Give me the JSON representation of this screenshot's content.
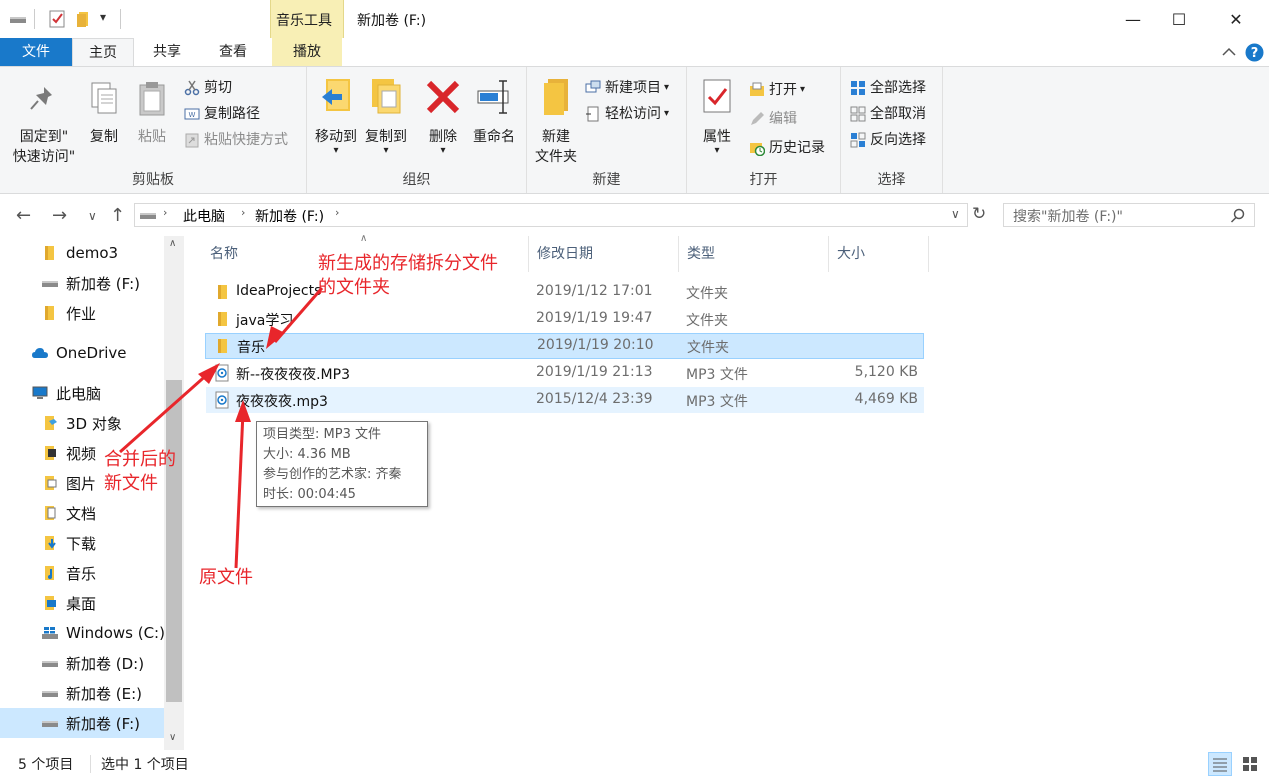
{
  "titlebar": {
    "context_tab": "音乐工具",
    "window_title": "新加卷 (F:)",
    "qat_dropdown": "▾",
    "minimize": "—",
    "maximize": "☐",
    "close": "✕"
  },
  "tabs": {
    "file": "文件",
    "home": "主页",
    "share": "共享",
    "view": "查看",
    "play": "播放"
  },
  "ribbon": {
    "clipboard": {
      "pin_line1": "固定到\"",
      "pin_line2": "快速访问\"",
      "copy": "复制",
      "paste": "粘贴",
      "cut": "剪切",
      "copy_path": "复制路径",
      "paste_shortcut": "粘贴快捷方式",
      "label": "剪贴板"
    },
    "organize": {
      "move_to": "移动到",
      "copy_to": "复制到",
      "delete": "删除",
      "rename": "重命名",
      "label": "组织"
    },
    "new": {
      "new_folder_line1": "新建",
      "new_folder_line2": "文件夹",
      "new_item": "新建项目",
      "easy_access": "轻松访问",
      "label": "新建"
    },
    "open": {
      "properties": "属性",
      "open": "打开",
      "edit": "编辑",
      "history": "历史记录",
      "label": "打开"
    },
    "select": {
      "select_all": "全部选择",
      "select_none": "全部取消",
      "invert": "反向选择",
      "label": "选择"
    }
  },
  "address": {
    "crumbs": [
      "此电脑",
      "新加卷 (F:)"
    ],
    "search_placeholder": "搜索\"新加卷 (F:)\""
  },
  "nav": {
    "items": [
      {
        "label": "demo3",
        "icon": "folder-icon"
      },
      {
        "label": "新加卷 (F:)",
        "icon": "drive-icon"
      },
      {
        "label": "作业",
        "icon": "folder-icon"
      },
      {
        "label": "OneDrive",
        "icon": "cloud-icon"
      },
      {
        "label": "此电脑",
        "icon": "computer-icon"
      },
      {
        "label": "3D 对象",
        "icon": "3d-objects-icon"
      },
      {
        "label": "视频",
        "icon": "video-folder-icon"
      },
      {
        "label": "图片",
        "icon": "pictures-folder-icon"
      },
      {
        "label": "文档",
        "icon": "documents-folder-icon"
      },
      {
        "label": "下载",
        "icon": "downloads-folder-icon"
      },
      {
        "label": "音乐",
        "icon": "music-folder-icon"
      },
      {
        "label": "桌面",
        "icon": "desktop-folder-icon"
      },
      {
        "label": "Windows (C:)",
        "icon": "windows-drive-icon"
      },
      {
        "label": "新加卷 (D:)",
        "icon": "drive-icon"
      },
      {
        "label": "新加卷 (E:)",
        "icon": "drive-icon"
      },
      {
        "label": "新加卷 (F:)",
        "icon": "drive-icon"
      }
    ]
  },
  "list": {
    "headers": [
      "名称",
      "修改日期",
      "类型",
      "大小"
    ],
    "rows": [
      {
        "name": "IdeaProjects",
        "date": "2019/1/12 17:01",
        "type": "文件夹",
        "size": "",
        "icon": "folder-icon"
      },
      {
        "name": "java学习",
        "date": "2019/1/19 19:47",
        "type": "文件夹",
        "size": "",
        "icon": "folder-icon"
      },
      {
        "name": "音乐",
        "date": "2019/1/19 20:10",
        "type": "文件夹",
        "size": "",
        "icon": "folder-icon"
      },
      {
        "name": "新--夜夜夜夜.MP3",
        "date": "2019/1/19 21:13",
        "type": "MP3 文件",
        "size": "5,120 KB",
        "icon": "mp3-file-icon"
      },
      {
        "name": "夜夜夜夜.mp3",
        "date": "2015/12/4 23:39",
        "type": "MP3 文件",
        "size": "4,469 KB",
        "icon": "mp3-file-icon"
      }
    ]
  },
  "tooltip": {
    "type": "项目类型: MP3 文件",
    "size": "大小: 4.36 MB",
    "artist": "参与创作的艺术家: 齐秦",
    "length": "时长: 00:04:45"
  },
  "annotations": {
    "new_folder_line1": "新生成的存储拆分文件",
    "new_folder_line2": "的文件夹",
    "merged_line1": "合并后的",
    "merged_line2": "新文件",
    "original": "原文件"
  },
  "status": {
    "count": "5 个项目",
    "selected": "选中 1 个项目"
  },
  "colors": {
    "file_tab": "#1979ca",
    "selection": "#cce8ff",
    "context_tab": "#f8efb5",
    "annotation": "#e8262b"
  }
}
